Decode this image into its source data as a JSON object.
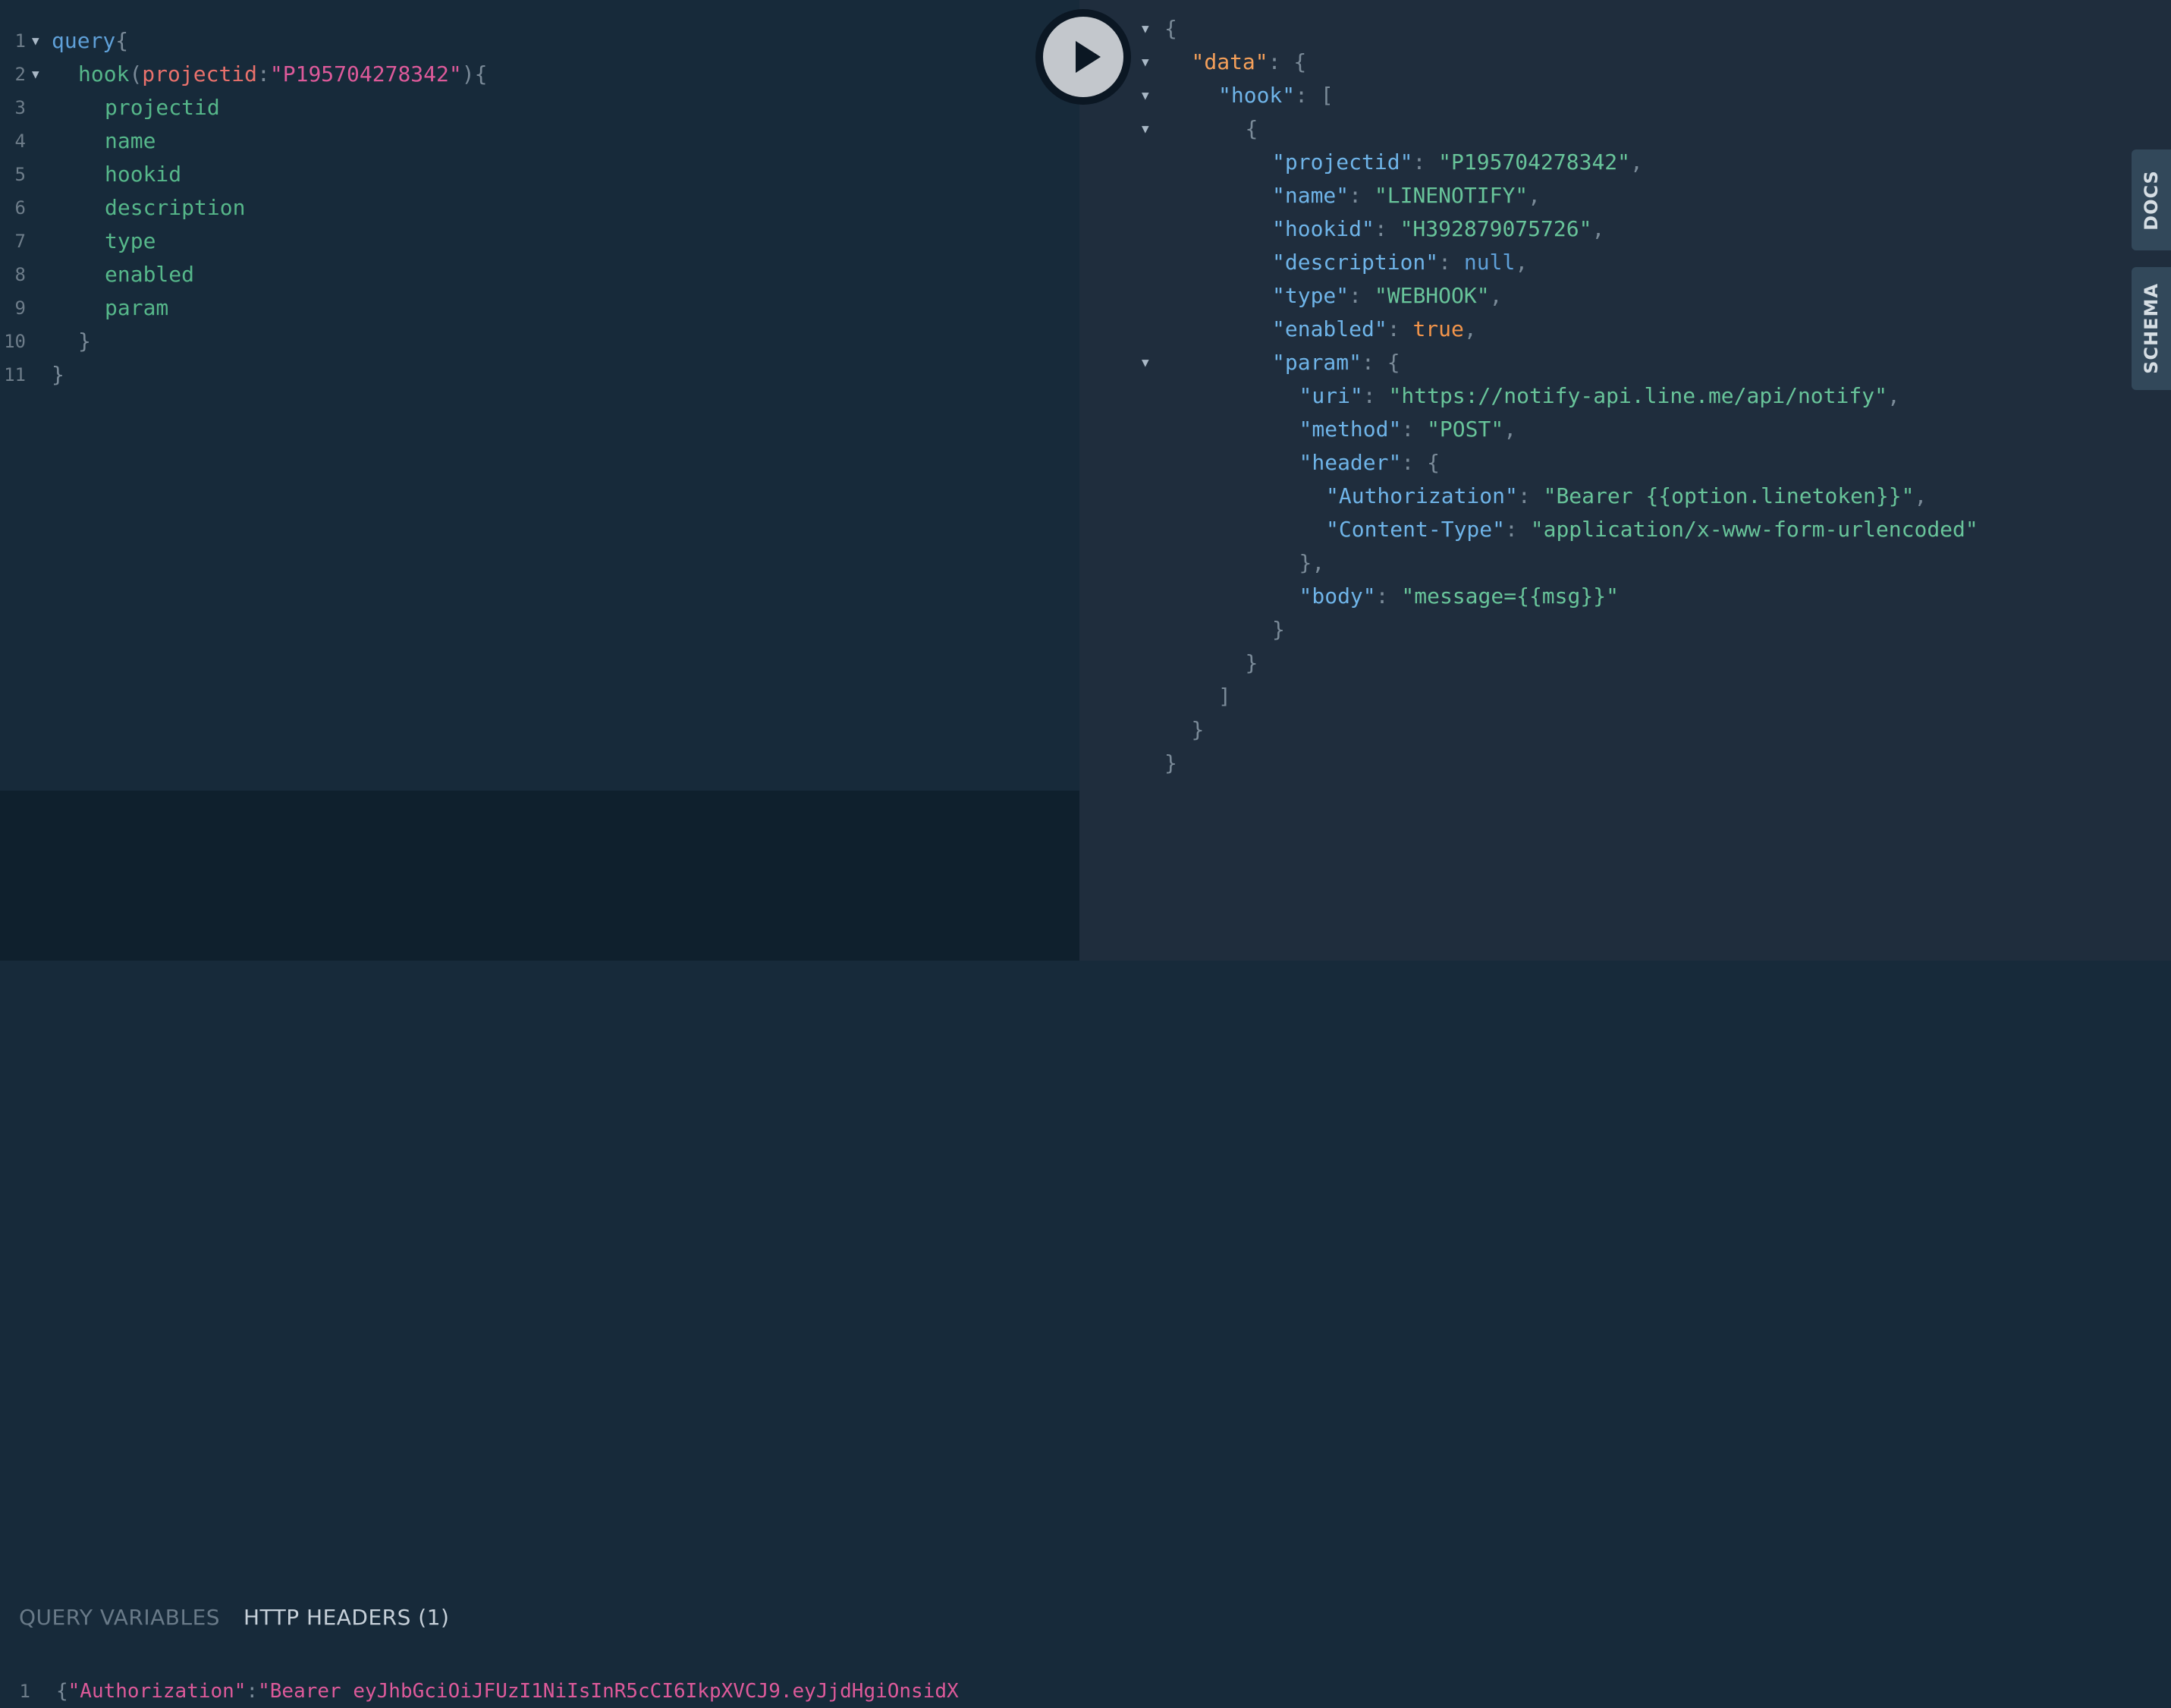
{
  "query_editor": {
    "lines": [
      {
        "n": "1",
        "fold": true,
        "indent": 0,
        "tokens": [
          {
            "t": "query",
            "c": "kw"
          },
          {
            "t": "{",
            "c": "punct"
          }
        ]
      },
      {
        "n": "2",
        "fold": true,
        "indent": 1,
        "tokens": [
          {
            "t": "hook",
            "c": "field"
          },
          {
            "t": "(",
            "c": "punct"
          },
          {
            "t": "projectid",
            "c": "arg"
          },
          {
            "t": ":",
            "c": "punct"
          },
          {
            "t": "\"P195704278342\"",
            "c": "str"
          },
          {
            "t": "){",
            "c": "punct"
          }
        ]
      },
      {
        "n": "3",
        "fold": false,
        "indent": 2,
        "tokens": [
          {
            "t": "projectid",
            "c": "field"
          }
        ]
      },
      {
        "n": "4",
        "fold": false,
        "indent": 2,
        "tokens": [
          {
            "t": "name",
            "c": "field"
          }
        ]
      },
      {
        "n": "5",
        "fold": false,
        "indent": 2,
        "tokens": [
          {
            "t": "hookid",
            "c": "field"
          }
        ]
      },
      {
        "n": "6",
        "fold": false,
        "indent": 2,
        "tokens": [
          {
            "t": "description",
            "c": "field"
          }
        ]
      },
      {
        "n": "7",
        "fold": false,
        "indent": 2,
        "tokens": [
          {
            "t": "type",
            "c": "field"
          }
        ]
      },
      {
        "n": "8",
        "fold": false,
        "indent": 2,
        "tokens": [
          {
            "t": "enabled",
            "c": "field"
          }
        ]
      },
      {
        "n": "9",
        "fold": false,
        "indent": 2,
        "tokens": [
          {
            "t": "param",
            "c": "field"
          }
        ]
      },
      {
        "n": "10",
        "fold": false,
        "indent": 1,
        "tokens": [
          {
            "t": "}",
            "c": "punct"
          }
        ]
      },
      {
        "n": "11",
        "fold": false,
        "indent": 0,
        "tokens": [
          {
            "t": "}",
            "c": "punct"
          }
        ]
      }
    ]
  },
  "bottom_panel": {
    "tabs": [
      "QUERY VARIABLES",
      "HTTP HEADERS (1)"
    ],
    "active_tab": 1,
    "header_line": {
      "n": "1",
      "tokens": [
        {
          "t": "{",
          "c": "punct"
        },
        {
          "t": "\"Authorization\"",
          "c": "str"
        },
        {
          "t": ":",
          "c": "punct"
        },
        {
          "t": "\"Bearer eyJhbGciOiJFUzI1NiIsInR5cCI6IkpXVCJ9.eyJjdHgiOnsidX",
          "c": "str"
        }
      ]
    }
  },
  "run_button": {
    "label": "Execute Query"
  },
  "result": {
    "lines": [
      {
        "fold": true,
        "indent": 0,
        "tokens": [
          {
            "t": "{",
            "c": "punct"
          }
        ]
      },
      {
        "fold": true,
        "indent": 1,
        "tokens": [
          {
            "t": "\"data\"",
            "c": "key2"
          },
          {
            "t": ": {",
            "c": "punct"
          }
        ]
      },
      {
        "fold": true,
        "indent": 2,
        "tokens": [
          {
            "t": "\"hook\"",
            "c": "key"
          },
          {
            "t": ": [",
            "c": "punct"
          }
        ]
      },
      {
        "fold": true,
        "indent": 3,
        "tokens": [
          {
            "t": "{",
            "c": "punct"
          }
        ]
      },
      {
        "fold": false,
        "indent": 4,
        "tokens": [
          {
            "t": "\"projectid\"",
            "c": "key"
          },
          {
            "t": ": ",
            "c": "punct"
          },
          {
            "t": "\"P195704278342\"",
            "c": "jstr"
          },
          {
            "t": ",",
            "c": "punct"
          }
        ]
      },
      {
        "fold": false,
        "indent": 4,
        "tokens": [
          {
            "t": "\"name\"",
            "c": "key"
          },
          {
            "t": ": ",
            "c": "punct"
          },
          {
            "t": "\"LINENOTIFY\"",
            "c": "jstr"
          },
          {
            "t": ",",
            "c": "punct"
          }
        ]
      },
      {
        "fold": false,
        "indent": 4,
        "tokens": [
          {
            "t": "\"hookid\"",
            "c": "key"
          },
          {
            "t": ": ",
            "c": "punct"
          },
          {
            "t": "\"H392879075726\"",
            "c": "jstr"
          },
          {
            "t": ",",
            "c": "punct"
          }
        ]
      },
      {
        "fold": false,
        "indent": 4,
        "tokens": [
          {
            "t": "\"description\"",
            "c": "key"
          },
          {
            "t": ": ",
            "c": "punct"
          },
          {
            "t": "null",
            "c": "jnull"
          },
          {
            "t": ",",
            "c": "punct"
          }
        ]
      },
      {
        "fold": false,
        "indent": 4,
        "tokens": [
          {
            "t": "\"type\"",
            "c": "key"
          },
          {
            "t": ": ",
            "c": "punct"
          },
          {
            "t": "\"WEBHOOK\"",
            "c": "jstr"
          },
          {
            "t": ",",
            "c": "punct"
          }
        ]
      },
      {
        "fold": false,
        "indent": 4,
        "tokens": [
          {
            "t": "\"enabled\"",
            "c": "key"
          },
          {
            "t": ": ",
            "c": "punct"
          },
          {
            "t": "true",
            "c": "jbool"
          },
          {
            "t": ",",
            "c": "punct"
          }
        ]
      },
      {
        "fold": true,
        "indent": 4,
        "tokens": [
          {
            "t": "\"param\"",
            "c": "key"
          },
          {
            "t": ": {",
            "c": "punct"
          }
        ]
      },
      {
        "fold": false,
        "indent": 5,
        "tokens": [
          {
            "t": "\"uri\"",
            "c": "key"
          },
          {
            "t": ": ",
            "c": "punct"
          },
          {
            "t": "\"https://notify-api.line.me/api/notify\"",
            "c": "jstr"
          },
          {
            "t": ",",
            "c": "punct"
          }
        ]
      },
      {
        "fold": false,
        "indent": 5,
        "tokens": [
          {
            "t": "\"method\"",
            "c": "key"
          },
          {
            "t": ": ",
            "c": "punct"
          },
          {
            "t": "\"POST\"",
            "c": "jstr"
          },
          {
            "t": ",",
            "c": "punct"
          }
        ]
      },
      {
        "fold": false,
        "indent": 5,
        "tokens": [
          {
            "t": "\"header\"",
            "c": "key"
          },
          {
            "t": ": {",
            "c": "punct"
          }
        ]
      },
      {
        "fold": false,
        "indent": 6,
        "tokens": [
          {
            "t": "\"Authorization\"",
            "c": "key"
          },
          {
            "t": ": ",
            "c": "punct"
          },
          {
            "t": "\"Bearer {{option.linetoken}}\"",
            "c": "jstr"
          },
          {
            "t": ",",
            "c": "punct"
          }
        ]
      },
      {
        "fold": false,
        "indent": 6,
        "tokens": [
          {
            "t": "\"Content-Type\"",
            "c": "key"
          },
          {
            "t": ": ",
            "c": "punct"
          },
          {
            "t": "\"application/x-www-form-urlencoded\"",
            "c": "jstr"
          }
        ]
      },
      {
        "fold": false,
        "indent": 5,
        "tokens": [
          {
            "t": "},",
            "c": "punct"
          }
        ]
      },
      {
        "fold": false,
        "indent": 5,
        "tokens": [
          {
            "t": "\"body\"",
            "c": "key"
          },
          {
            "t": ": ",
            "c": "punct"
          },
          {
            "t": "\"message={{msg}}\"",
            "c": "jstr"
          }
        ]
      },
      {
        "fold": false,
        "indent": 4,
        "tokens": [
          {
            "t": "}",
            "c": "punct"
          }
        ]
      },
      {
        "fold": false,
        "indent": 3,
        "tokens": [
          {
            "t": "}",
            "c": "punct"
          }
        ]
      },
      {
        "fold": false,
        "indent": 2,
        "tokens": [
          {
            "t": "]",
            "c": "punct"
          }
        ]
      },
      {
        "fold": false,
        "indent": 1,
        "tokens": [
          {
            "t": "}",
            "c": "punct"
          }
        ]
      },
      {
        "fold": false,
        "indent": 0,
        "tokens": [
          {
            "t": "}",
            "c": "punct"
          }
        ]
      }
    ]
  },
  "side_tabs": [
    "DOCS",
    "SCHEMA"
  ],
  "colors": {
    "editor_bg": "#172a3a",
    "result_bg": "#1f2d3d",
    "bottom_bg": "#0f202d",
    "string": "#dd5a9a",
    "field": "#56b78a",
    "keyword": "#5fa0d8"
  }
}
